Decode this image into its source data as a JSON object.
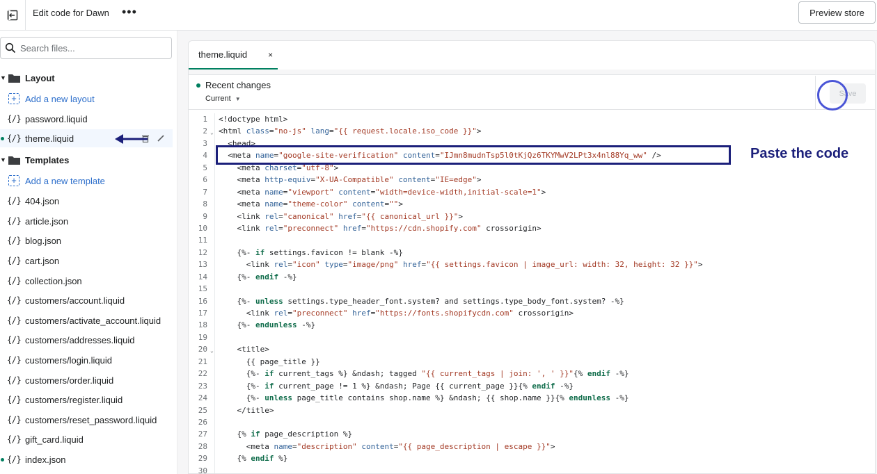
{
  "topbar": {
    "title": "Edit code for Dawn",
    "more_label": "•••",
    "preview_label": "Preview store"
  },
  "sidebar": {
    "search_placeholder": "Search files...",
    "layout_folder": "Layout",
    "add_layout": "Add a new layout",
    "layout_files": [
      "password.liquid",
      "theme.liquid"
    ],
    "templates_folder": "Templates",
    "add_template": "Add a new template",
    "template_files": [
      "404.json",
      "article.json",
      "blog.json",
      "cart.json",
      "collection.json",
      "customers/account.liquid",
      "customers/activate_account.liquid",
      "customers/addresses.liquid",
      "customers/login.liquid",
      "customers/order.liquid",
      "customers/register.liquid",
      "customers/reset_password.liquid",
      "gift_card.liquid",
      "index.json"
    ],
    "file_icon": "{/}"
  },
  "editor": {
    "tab_label": "theme.liquid",
    "tab_close": "×",
    "recent_changes": "Recent changes",
    "changes_select": "Current",
    "save_label": "Save",
    "annotation": "Paste the code"
  },
  "code_lines": [
    "<!doctype html>",
    "<html class=\"no-js\" lang=\"{{ request.locale.iso_code }}\">",
    "  <head>",
    "  <meta name=\"google-site-verification\" content=\"IJmn8mudnTsp5l0tKjQz6TKYMwV2LPt3x4nl88Yq_ww\" />",
    "    <meta charset=\"utf-8\">",
    "    <meta http-equiv=\"X-UA-Compatible\" content=\"IE=edge\">",
    "    <meta name=\"viewport\" content=\"width=device-width,initial-scale=1\">",
    "    <meta name=\"theme-color\" content=\"\">",
    "    <link rel=\"canonical\" href=\"{{ canonical_url }}\">",
    "    <link rel=\"preconnect\" href=\"https://cdn.shopify.com\" crossorigin>",
    "",
    "    {%- if settings.favicon != blank -%}",
    "      <link rel=\"icon\" type=\"image/png\" href=\"{{ settings.favicon | image_url: width: 32, height: 32 }}\">",
    "    {%- endif -%}",
    "",
    "    {%- unless settings.type_header_font.system? and settings.type_body_font.system? -%}",
    "      <link rel=\"preconnect\" href=\"https://fonts.shopifycdn.com\" crossorigin>",
    "    {%- endunless -%}",
    "",
    "    <title>",
    "      {{ page_title }}",
    "      {%- if current_tags %} &ndash; tagged \"{{ current_tags | join: ', ' }}\"{% endif -%}",
    "      {%- if current_page != 1 %} &ndash; Page {{ current_page }}{% endif -%}",
    "      {%- unless page_title contains shop.name %} &ndash; {{ shop.name }}{% endunless -%}",
    "    </title>",
    "",
    "    {% if page_description %}",
    "      <meta name=\"description\" content=\"{{ page_description | escape }}\">",
    "    {% endif %}",
    ""
  ],
  "colors": {
    "accent_green": "#008060",
    "annotation_navy": "#1b1f7a",
    "link_blue": "#2c6ecb",
    "circle_blue": "#4a55d6"
  }
}
